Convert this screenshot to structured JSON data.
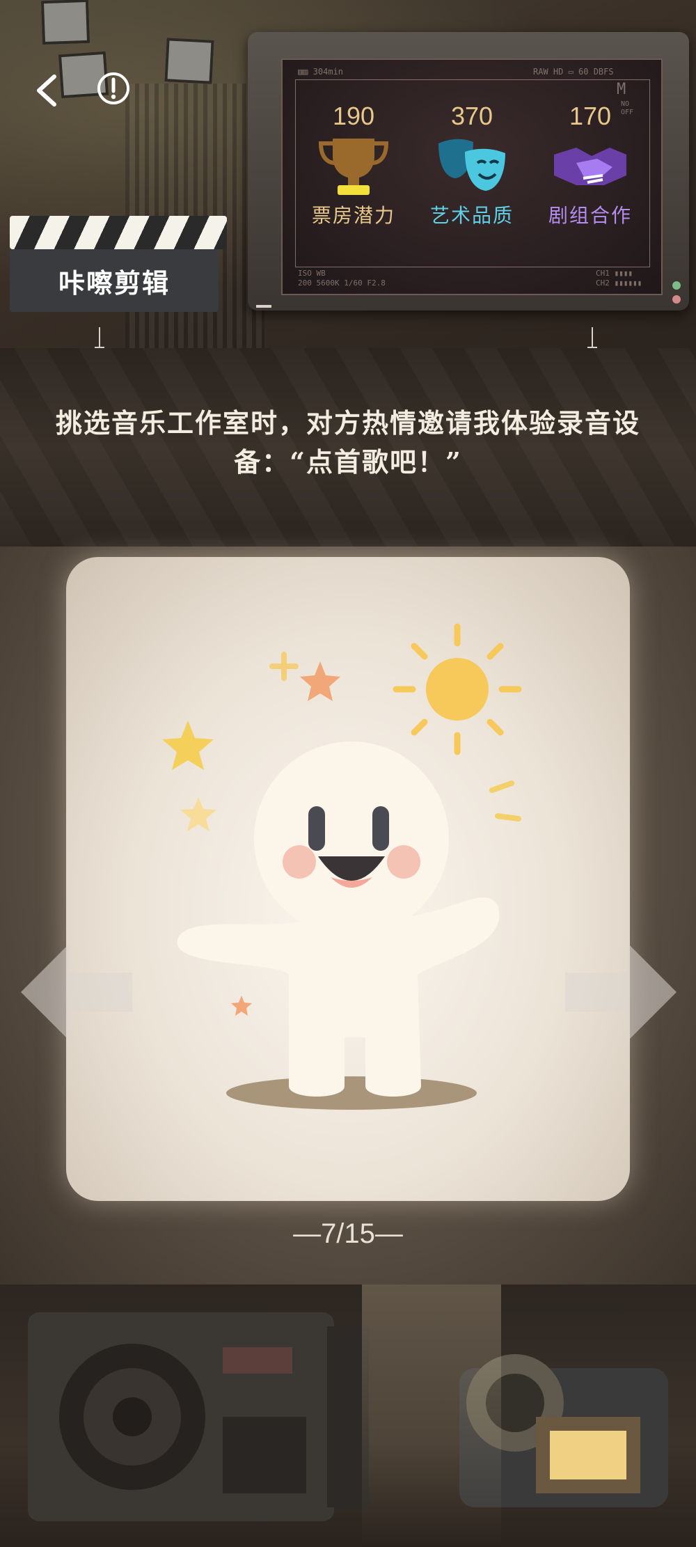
{
  "header": {
    "back_icon": "chevron-left-icon",
    "info_icon": "exclamation-circle-icon"
  },
  "clapper": {
    "title": "咔嚓剪辑"
  },
  "monitor": {
    "stats": [
      {
        "value": "190",
        "label": "票房潜力",
        "icon": "trophy-icon",
        "color": "#e9c98b"
      },
      {
        "value": "370",
        "label": "艺术品质",
        "icon": "theater-masks-icon",
        "color": "#5fd0e6"
      },
      {
        "value": "170",
        "label": "剧组合作",
        "icon": "handshake-icon",
        "color": "#b58cf0"
      }
    ]
  },
  "dialog": {
    "text": "挑选音乐工作室时，对方热情邀请我体验录音设备：“点首歌吧！”"
  },
  "card": {
    "illustration": "happy-character-illustration"
  },
  "pagination": {
    "text": "—7/15—",
    "current": 7,
    "total": 15
  }
}
